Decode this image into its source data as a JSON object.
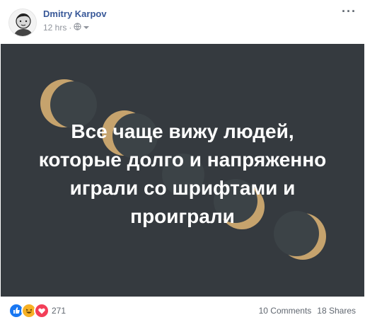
{
  "post": {
    "author": "Dmitry Karpov",
    "time": "12 hrs",
    "separator": "·",
    "more_label": "···"
  },
  "image": {
    "lines": [
      "Все чаще вижу людей,",
      "которые долго и напряженно",
      "играли со шрифтами и",
      "проиграли"
    ]
  },
  "footer": {
    "reaction_count": "271",
    "comments": "10 Comments",
    "shares": "18 Shares"
  },
  "colors": {
    "background": "#353a3f",
    "moon_gold": "#c6a36d",
    "moon_dark": "#3c4347",
    "author_link": "#385898"
  },
  "icons": [
    "globe-icon",
    "chevron-down-icon",
    "like-reaction-icon",
    "haha-reaction-icon",
    "love-reaction-icon"
  ]
}
